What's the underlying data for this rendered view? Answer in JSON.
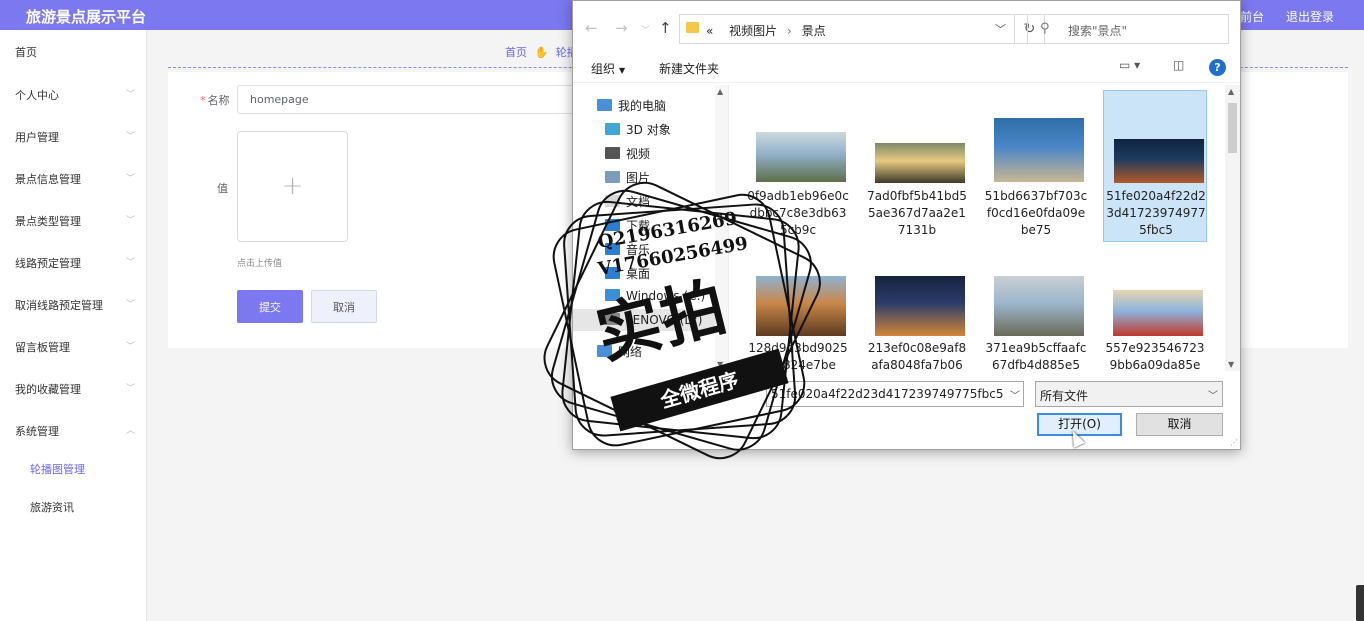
{
  "header": {
    "title": "旅游景点展示平台",
    "links": [
      "前台",
      "退出登录"
    ]
  },
  "sidebar": {
    "items": [
      {
        "label": "首页"
      },
      {
        "label": "个人中心"
      },
      {
        "label": "用户管理"
      },
      {
        "label": "景点信息管理"
      },
      {
        "label": "景点类型管理"
      },
      {
        "label": "线路预定管理"
      },
      {
        "label": "取消线路预定管理"
      },
      {
        "label": "留言板管理"
      },
      {
        "label": "我的收藏管理"
      },
      {
        "label": "系统管理"
      }
    ],
    "sub_items": [
      {
        "label": "轮播图管理"
      },
      {
        "label": "旅游资讯"
      }
    ]
  },
  "breadcrumb": {
    "home": "首页",
    "current": "轮播"
  },
  "form": {
    "name_label": "名称",
    "name_value": "homepage",
    "value_label": "值",
    "upload_tip": "点击上传值",
    "submit_label": "提交",
    "cancel_label": "取消"
  },
  "dialog": {
    "path": [
      "视频图片",
      "景点"
    ],
    "path_prefix": "«",
    "search_placeholder": "搜索\"景点\"",
    "organize_label": "组织",
    "new_folder_label": "新建文件夹",
    "nav_tree": [
      {
        "label": "我的电脑",
        "icon": "computer-icon"
      },
      {
        "label": "3D 对象",
        "icon": "3d-objects-icon"
      },
      {
        "label": "视频",
        "icon": "video-icon"
      },
      {
        "label": "图片",
        "icon": "pictures-icon"
      },
      {
        "label": "文档",
        "icon": "documents-icon"
      },
      {
        "label": "下载",
        "icon": "download-icon"
      },
      {
        "label": "音乐",
        "icon": "music-icon"
      },
      {
        "label": "桌面",
        "icon": "desktop-icon"
      },
      {
        "label": "Windows (C:)",
        "icon": "drive-icon"
      },
      {
        "label": "LENOVO (D:)",
        "icon": "drive-icon"
      },
      {
        "label": "网络",
        "icon": "network-icon"
      }
    ],
    "files": [
      {
        "name": "0f9adb1eb96e0cdbbc7c8e3db635cb9c",
        "selected": false,
        "colors": [
          "#8fb0c8",
          "#5f6f4a",
          "#cdd9de"
        ]
      },
      {
        "name": "7ad0fbf5b41bd55ae367d7aa2e17131b",
        "selected": false,
        "colors": [
          "#e8c980",
          "#3b3a2a",
          "#7d8a6a"
        ]
      },
      {
        "name": "51bd6637bf703cf0cd16e0fda09ebe75",
        "selected": false,
        "colors": [
          "#4a86c8",
          "#c9b693",
          "#2f6ea8"
        ]
      },
      {
        "name": "51fe020a4f22d23d417239749775fbc5",
        "selected": true,
        "colors": [
          "#1d3a5e",
          "#b25a2b",
          "#0f2340"
        ]
      },
      {
        "name": "128d9d3bd9025bb5824e7be",
        "selected": false,
        "colors": [
          "#c9874a",
          "#5d3a1f",
          "#8fb2d2"
        ]
      },
      {
        "name": "213ef0c08e9af8afa8048fa7b06",
        "selected": false,
        "colors": [
          "#2a3c6a",
          "#d2863a",
          "#16243f"
        ]
      },
      {
        "name": "371ea9b5cffaafc67dfb4d885e5",
        "selected": false,
        "colors": [
          "#9cb7cc",
          "#6b6a5a",
          "#c9cfd4"
        ]
      },
      {
        "name": "557e9235467239bb6a09da85e",
        "selected": false,
        "colors": [
          "#8db5e0",
          "#c0392b",
          "#e8d5b0"
        ]
      }
    ],
    "filename_value": "51fe020a4f22d23d417239749775fbc5",
    "filetype_value": "所有文件",
    "open_label": "打开(O)",
    "cancel_label": "取消"
  },
  "watermark": {
    "line1": "Q2196316269",
    "line2": "V17660256499",
    "big": "实拍",
    "ribbon": "全微程序"
  }
}
